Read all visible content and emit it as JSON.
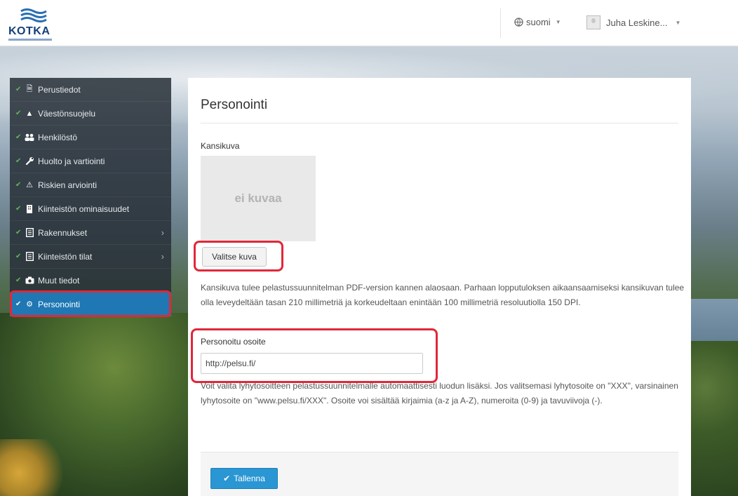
{
  "header": {
    "logo_text": "KOTKA",
    "language": "suomi",
    "user_name": "Juha Leskine..."
  },
  "sidebar": {
    "items": [
      {
        "label": "Perustiedot",
        "icon": "document-icon",
        "has_children": false
      },
      {
        "label": "Väestönsuojelu",
        "icon": "triangle-icon",
        "has_children": false
      },
      {
        "label": "Henkilöstö",
        "icon": "users-icon",
        "has_children": false
      },
      {
        "label": "Huolto ja vartiointi",
        "icon": "wrench-icon",
        "has_children": false
      },
      {
        "label": "Riskien arviointi",
        "icon": "warning-icon",
        "has_children": false
      },
      {
        "label": "Kiinteistön ominaisuudet",
        "icon": "building-icon",
        "has_children": false
      },
      {
        "label": "Rakennukset",
        "icon": "file-icon",
        "has_children": true
      },
      {
        "label": "Kiinteistön tilat",
        "icon": "file-icon",
        "has_children": true
      },
      {
        "label": "Muut tiedot",
        "icon": "camera-icon",
        "has_children": false
      },
      {
        "label": "Personointi",
        "icon": "gear-icon",
        "has_children": false,
        "active": true
      }
    ]
  },
  "main": {
    "title": "Personointi",
    "cover_label": "Kansikuva",
    "cover_placeholder": "ei kuvaa",
    "choose_button": "Valitse kuva",
    "cover_help": "Kansikuva tulee pelastussuunnitelman PDF-version kannen alaosaan. Parhaan lopputuloksen aikaansaamiseksi kansikuvan tulee olla leveydeltään tasan 210 millimetriä ja korkeudeltaan enintään 100 millimetriä resoluutiolla 150 DPI.",
    "url_label": "Personoitu osoite",
    "url_value": "http://pelsu.fi/",
    "url_help": "Voit valita lyhytosoitteen pelastussuunnitelmalle automaattisesti luodun lisäksi. Jos valitsemasi lyhytosoite on \"XXX\", varsinainen lyhytosoite on \"www.pelsu.fi/XXX\". Osoite voi sisältää kirjaimia (a-z ja A-Z), numeroita (0-9) ja tavuviivoja (-).",
    "save_button": "Tallenna"
  },
  "colors": {
    "accent": "#1f77b4",
    "save_button": "#2a96d3",
    "highlight": "#e0283a",
    "check": "#5fb85c"
  }
}
